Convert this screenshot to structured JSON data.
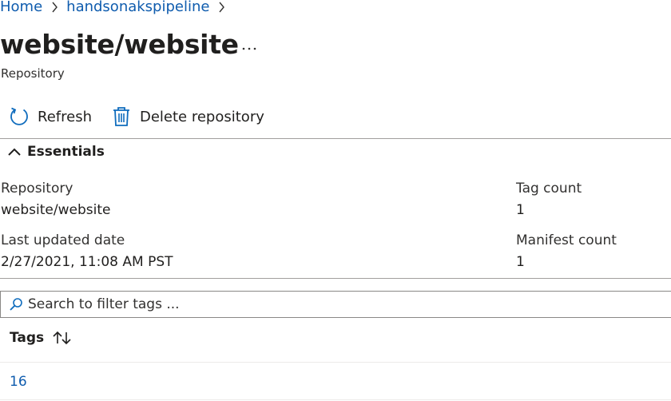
{
  "breadcrumb": {
    "items": [
      "Home",
      "handsonakspipeline"
    ]
  },
  "header": {
    "title": "website/website",
    "more_label": "...",
    "subtitle": "Repository"
  },
  "toolbar": {
    "refresh_label": "Refresh",
    "delete_label": "Delete repository"
  },
  "essentials": {
    "label": "Essentials",
    "repository_label": "Repository",
    "repository_value": "website/website",
    "last_updated_label": "Last updated date",
    "last_updated_value": "2/27/2021, 11:08 AM PST",
    "tag_count_label": "Tag count",
    "tag_count_value": "1",
    "manifest_count_label": "Manifest count",
    "manifest_count_value": "1"
  },
  "search": {
    "placeholder": "Search to filter tags ..."
  },
  "table": {
    "column_header": "Tags",
    "rows": [
      "16"
    ]
  },
  "colors": {
    "link": "#0f5cae",
    "text": "#201f1e",
    "divider": "#a19f9d"
  },
  "icons": [
    "chevron-right-icon",
    "more-icon",
    "refresh-icon",
    "trash-icon",
    "chevron-up-icon",
    "search-icon",
    "sort-icon"
  ]
}
